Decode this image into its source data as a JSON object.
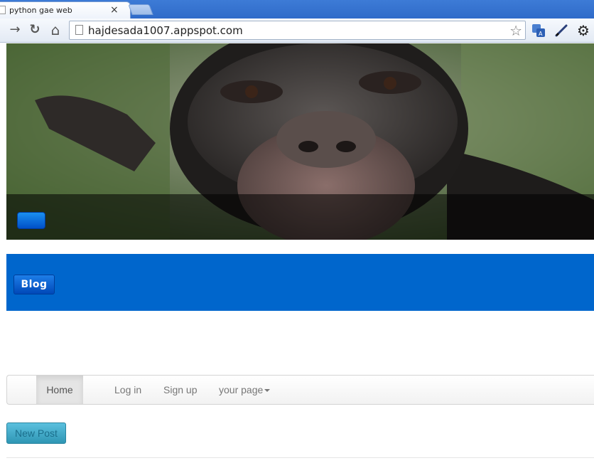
{
  "browser": {
    "tab_title": "python gae web",
    "tab_close": "×",
    "url": "hajdesada1007.appspot.com",
    "icons": [
      "forward-icon",
      "reload-icon",
      "home-icon",
      "page-icon",
      "bookmark-star-icon",
      "translate-icon",
      "pen-icon",
      "gear-icon"
    ],
    "glyphs": {
      "forward": "→",
      "reload": "↻",
      "home": "⌂",
      "star": "☆",
      "gear": "⚙"
    }
  },
  "hero": {
    "image": "chimpanzee close-up photo",
    "button_label": ""
  },
  "blog_bar": {
    "button_label": "Blog",
    "color": "#0066cc"
  },
  "navbar": {
    "items": [
      {
        "label": "Home",
        "active": true
      },
      {
        "label": "Log in",
        "active": false
      },
      {
        "label": "Sign up",
        "active": false
      },
      {
        "label": "your page",
        "active": false,
        "dropdown": true
      }
    ]
  },
  "actions": {
    "new_post_label": "New Post"
  }
}
